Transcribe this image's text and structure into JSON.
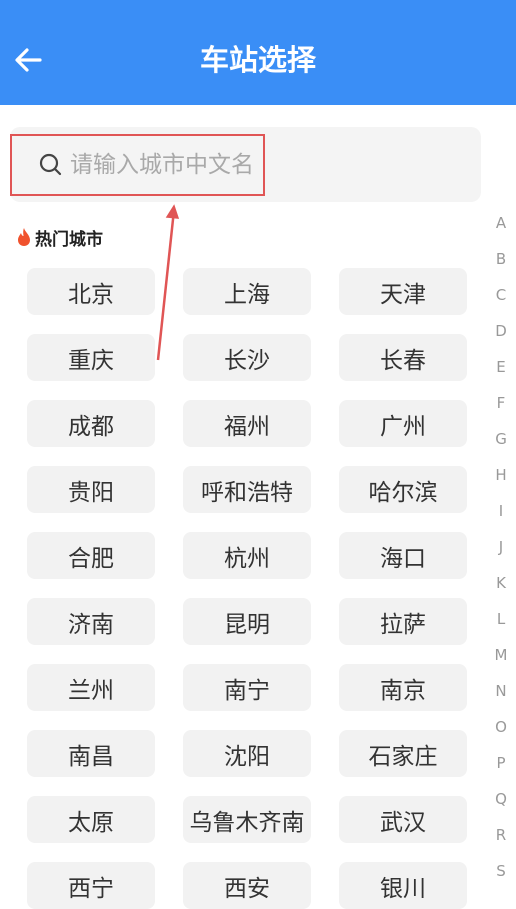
{
  "header": {
    "title": "车站选择",
    "back_icon": "arrow-left-icon"
  },
  "search": {
    "placeholder": "请输入城市中文名",
    "value": "",
    "icon": "search-icon"
  },
  "hot": {
    "title": "热门城市",
    "icon": "fire-icon",
    "icon_color": "#f0522d"
  },
  "cities": [
    "北京",
    "上海",
    "天津",
    "重庆",
    "长沙",
    "长春",
    "成都",
    "福州",
    "广州",
    "贵阳",
    "呼和浩特",
    "哈尔滨",
    "合肥",
    "杭州",
    "海口",
    "济南",
    "昆明",
    "拉萨",
    "兰州",
    "南宁",
    "南京",
    "南昌",
    "沈阳",
    "石家庄",
    "太原",
    "乌鲁木齐南",
    "武汉",
    "西宁",
    "西安",
    "银川"
  ],
  "index_letters": [
    "A",
    "B",
    "C",
    "D",
    "E",
    "F",
    "G",
    "H",
    "I",
    "J",
    "K",
    "L",
    "M",
    "N",
    "O",
    "P",
    "Q",
    "R",
    "S"
  ],
  "colors": {
    "header_bg": "#3a8ef6",
    "highlight": "#e05555"
  }
}
